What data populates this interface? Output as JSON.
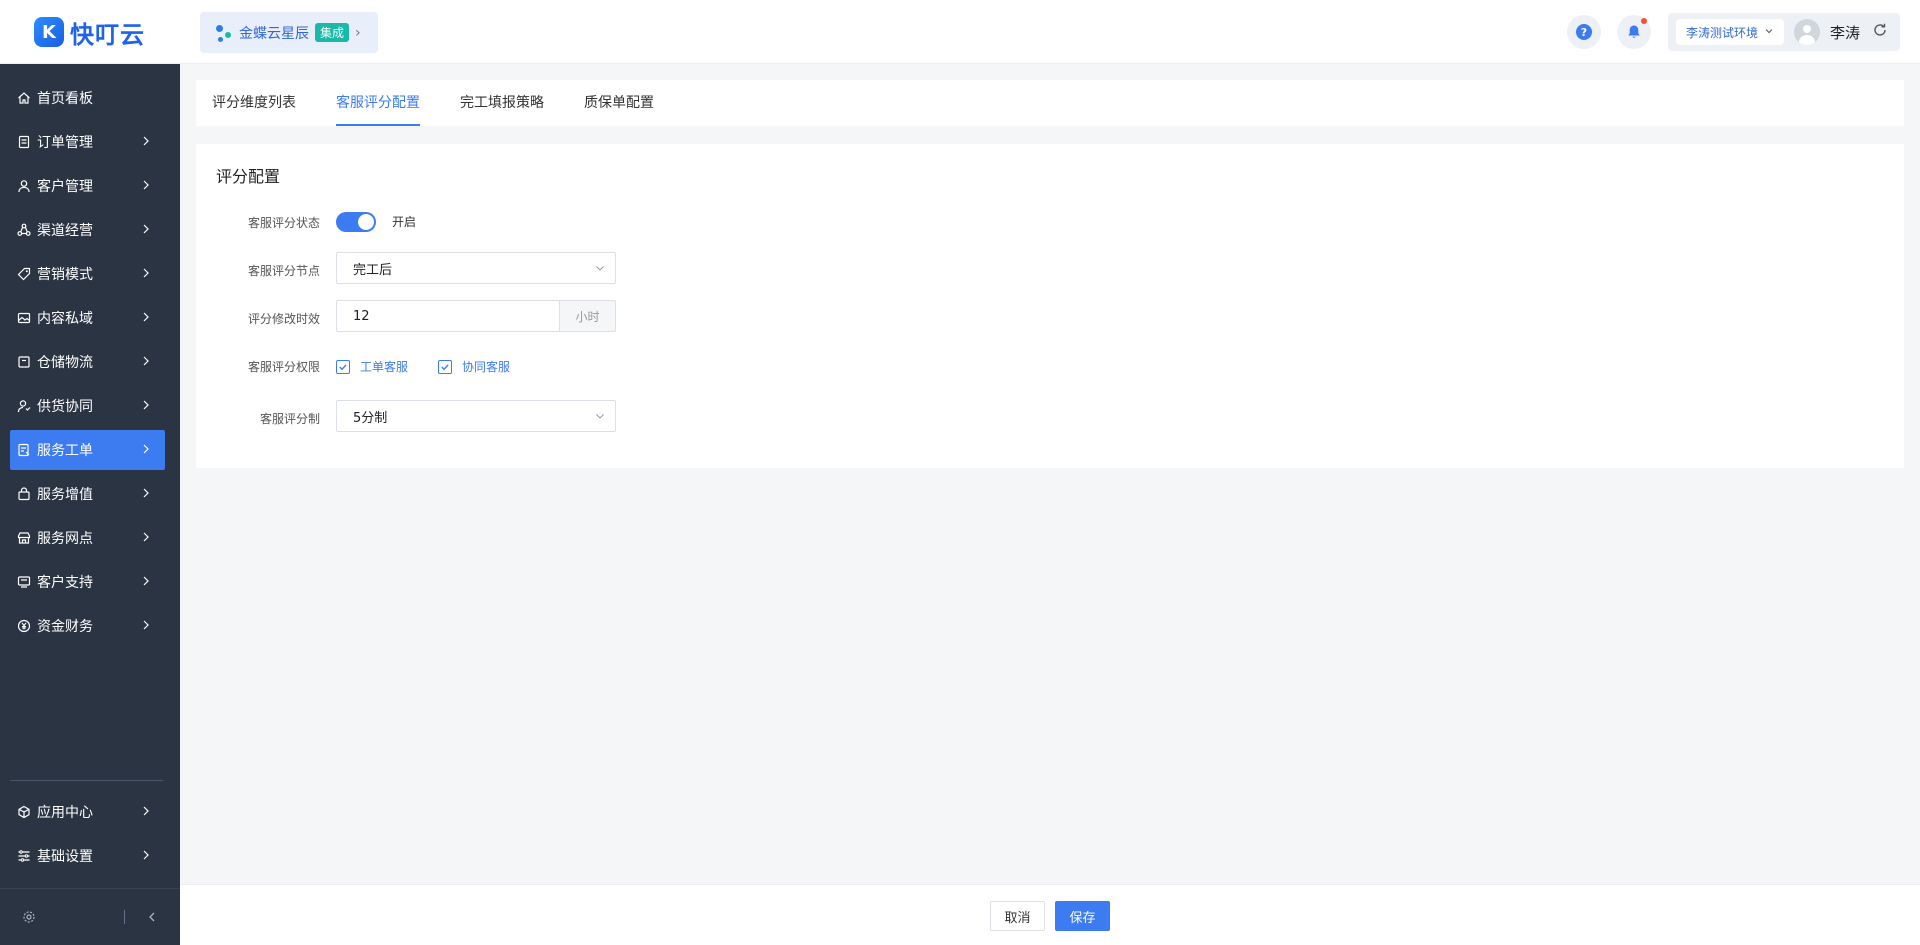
{
  "header": {
    "logo_text": "快叮云",
    "switcher": {
      "name": "金蝶云星辰",
      "badge": "集成"
    },
    "env": "李涛测试环境",
    "user": "李涛"
  },
  "sidebar": {
    "items": [
      {
        "label": "首页看板",
        "icon": "home-icon",
        "has_children": false,
        "active": false
      },
      {
        "label": "订单管理",
        "icon": "order-icon",
        "has_children": true,
        "active": false
      },
      {
        "label": "客户管理",
        "icon": "user-icon",
        "has_children": true,
        "active": false
      },
      {
        "label": "渠道经营",
        "icon": "channel-icon",
        "has_children": true,
        "active": false
      },
      {
        "label": "营销模式",
        "icon": "tag-icon",
        "has_children": true,
        "active": false
      },
      {
        "label": "内容私域",
        "icon": "image-icon",
        "has_children": true,
        "active": false
      },
      {
        "label": "仓储物流",
        "icon": "warehouse-icon",
        "has_children": true,
        "active": false
      },
      {
        "label": "供货协同",
        "icon": "supply-icon",
        "has_children": true,
        "active": false
      },
      {
        "label": "服务工单",
        "icon": "ticket-icon",
        "has_children": true,
        "active": true
      },
      {
        "label": "服务增值",
        "icon": "bag-icon",
        "has_children": true,
        "active": false
      },
      {
        "label": "服务网点",
        "icon": "store-icon",
        "has_children": true,
        "active": false
      },
      {
        "label": "客户支持",
        "icon": "support-icon",
        "has_children": true,
        "active": false
      },
      {
        "label": "资金财务",
        "icon": "yen-icon",
        "has_children": true,
        "active": false
      }
    ],
    "bottom_items": [
      {
        "label": "应用中心",
        "icon": "cube-icon"
      },
      {
        "label": "基础设置",
        "icon": "settings-list-icon"
      }
    ]
  },
  "tabs": [
    {
      "label": "评分维度列表",
      "active": false
    },
    {
      "label": "客服评分配置",
      "active": true
    },
    {
      "label": "完工填报策略",
      "active": false
    },
    {
      "label": "质保单配置",
      "active": false
    }
  ],
  "panel": {
    "title": "评分配置",
    "fields": {
      "status_label": "客服评分状态",
      "status_value": "开启",
      "node_label": "客服评分节点",
      "node_value": "完工后",
      "period_label": "评分修改时效",
      "period_value": "12",
      "period_unit": "小时",
      "permission_label": "客服评分权限",
      "permission_options": [
        "工单客服",
        "协同客服"
      ],
      "scale_label": "客服评分制",
      "scale_value": "5分制"
    }
  },
  "footer": {
    "cancel": "取消",
    "save": "保存"
  },
  "colors": {
    "primary": "#3d7bf0",
    "sidebar": "#2b3443"
  }
}
